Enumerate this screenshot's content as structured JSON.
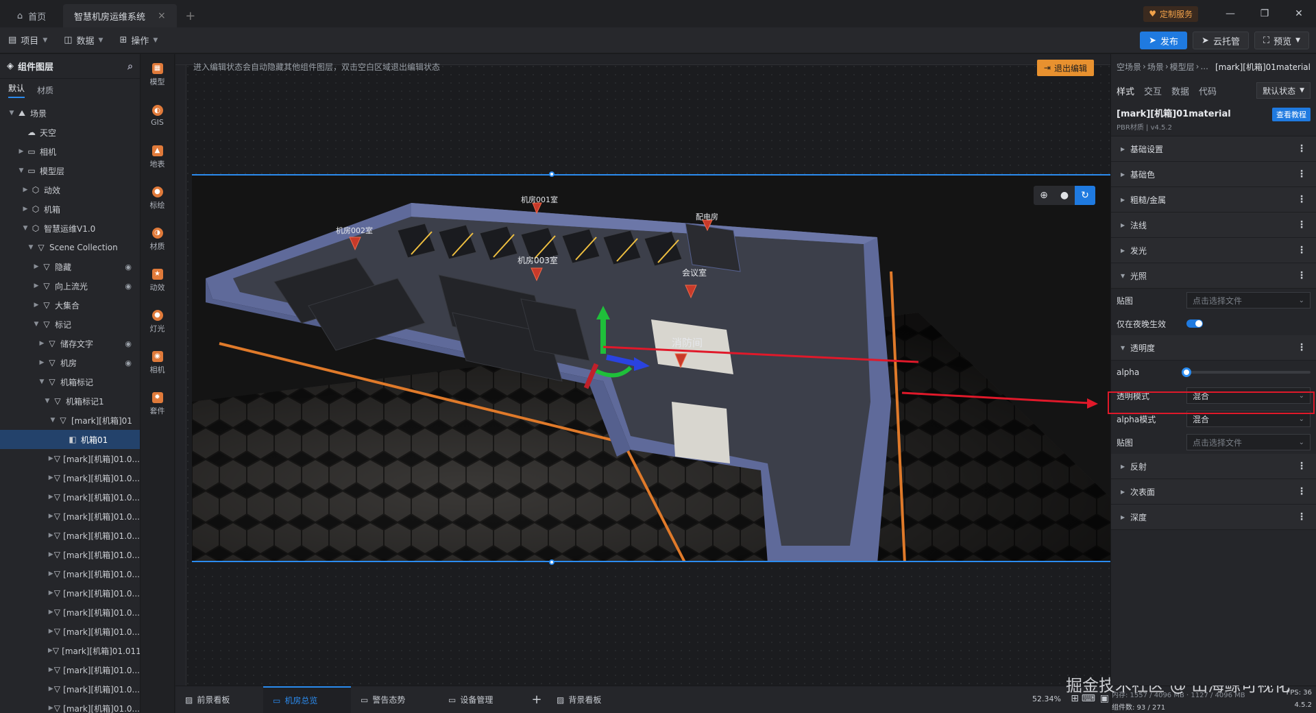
{
  "titlebar": {
    "tabs": [
      {
        "label": "首页"
      },
      {
        "label": "智慧机房运维系统"
      }
    ],
    "custom_service": "定制服务"
  },
  "menubar": {
    "items": [
      "项目",
      "数据",
      "操作"
    ],
    "publish": "发布",
    "cloud": "云托管",
    "preview": "预览"
  },
  "layers": {
    "title": "组件图层",
    "tabs": [
      "默认",
      "材质"
    ],
    "nodes": [
      {
        "label": "场景"
      },
      {
        "label": "天空"
      },
      {
        "label": "相机"
      },
      {
        "label": "模型层"
      },
      {
        "label": "动效"
      },
      {
        "label": "机箱"
      },
      {
        "label": "智慧运维V1.0"
      },
      {
        "label": "Scene Collection"
      },
      {
        "label": "隐藏"
      },
      {
        "label": "向上流光"
      },
      {
        "label": "大集合"
      },
      {
        "label": "标记"
      },
      {
        "label": "储存文字"
      },
      {
        "label": "机房"
      },
      {
        "label": "机箱标记"
      },
      {
        "label": "机箱标记1"
      },
      {
        "label": "[mark][机箱]01"
      },
      {
        "label": "机箱01"
      },
      {
        "label": "[mark][机箱]01.0..."
      },
      {
        "label": "[mark][机箱]01.0..."
      },
      {
        "label": "[mark][机箱]01.0..."
      },
      {
        "label": "[mark][机箱]01.0..."
      },
      {
        "label": "[mark][机箱]01.0..."
      },
      {
        "label": "[mark][机箱]01.0..."
      },
      {
        "label": "[mark][机箱]01.0..."
      },
      {
        "label": "[mark][机箱]01.0..."
      },
      {
        "label": "[mark][机箱]01.0..."
      },
      {
        "label": "[mark][机箱]01.0..."
      },
      {
        "label": "[mark][机箱]01.011"
      },
      {
        "label": "[mark][机箱]01.0..."
      },
      {
        "label": "[mark][机箱]01.0..."
      },
      {
        "label": "[mark][机箱]01.0..."
      }
    ]
  },
  "toolbar": {
    "items": [
      "模型",
      "GIS",
      "地表",
      "标绘",
      "材质",
      "动效",
      "灯光",
      "相机",
      "套件"
    ]
  },
  "canvas": {
    "notice": "进入编辑状态会自动隐藏其他组件图层，双击空白区域退出编辑状态",
    "exit_edit": "退出编辑",
    "labels": [
      "机房001室",
      "配电房",
      "机房002室",
      "机房003室",
      "会议室",
      "消防间"
    ]
  },
  "bottom": {
    "tabs": [
      "前景看板",
      "机房总览",
      "警告态势",
      "设备管理",
      "背景看板"
    ],
    "zoom": "52.34%"
  },
  "status": {
    "stats": "内存: 1557 / 4096 MB · 1127 / 4096 MB",
    "fps": "FPS: 36",
    "components": "组件数: 93 / 271",
    "version": "4.5.2"
  },
  "watermark": "掘金技术社区 @ 山海鲸可视化",
  "props": {
    "breadcrumb": [
      "空场景",
      "场景",
      "模型层",
      "..."
    ],
    "current": "[mark][机箱]01material",
    "tabs": [
      "样式",
      "交互",
      "数据",
      "代码"
    ],
    "state": "默认状态",
    "material_name": "[mark][机箱]01material",
    "material_sub": "PBR材质 | v4.5.2",
    "tutorial": "查看教程",
    "sections": [
      "基础设置",
      "基础色",
      "粗糙/金属",
      "法线",
      "发光",
      "光照",
      "透明度",
      "反射",
      "次表面",
      "深度"
    ],
    "texture_label": "贴图",
    "texture_placeholder": "点击选择文件",
    "night_only": "仅在夜晚生效",
    "alpha_label": "alpha",
    "alpha_value": 0,
    "transparent_mode_label": "透明模式",
    "transparent_mode_value": "混合",
    "alpha_mode_label": "alpha模式",
    "alpha_mode_value": "混合"
  }
}
